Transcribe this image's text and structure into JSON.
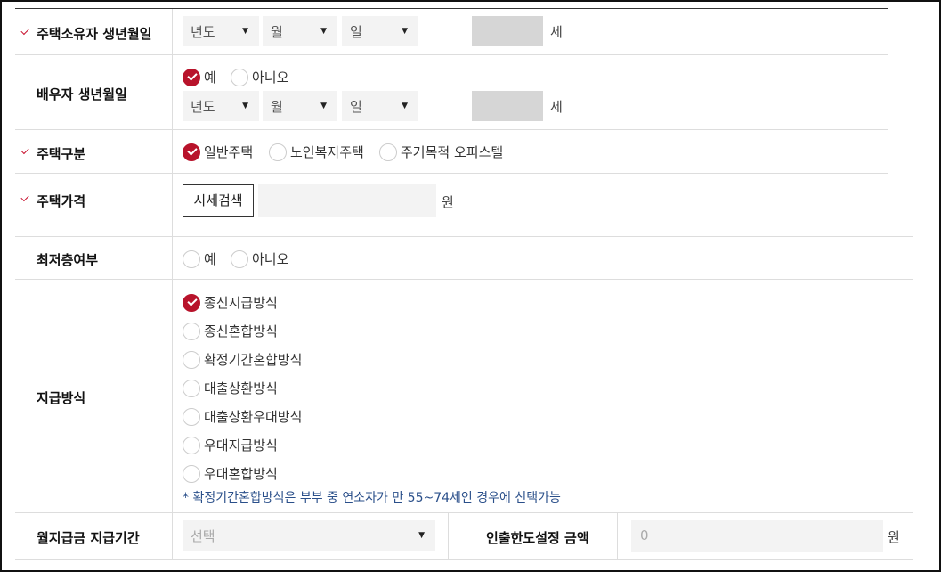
{
  "owner_birth": {
    "label": "주택소유자 생년월일",
    "year": "년도",
    "month": "월",
    "day": "일",
    "age_unit": "세"
  },
  "spouse_birth": {
    "label": "배우자 생년월일",
    "options": [
      "예",
      "아니오"
    ],
    "selected": "예",
    "year": "년도",
    "month": "월",
    "day": "일",
    "age_unit": "세"
  },
  "house_type": {
    "label": "주택구분",
    "options": [
      "일반주택",
      "노인복지주택",
      "주거목적 오피스텔"
    ],
    "selected": "일반주택"
  },
  "house_price": {
    "label": "주택가격",
    "search_button": "시세검색",
    "value": "",
    "unit": "원"
  },
  "lowest_floor": {
    "label": "최저층여부",
    "options": [
      "예",
      "아니오"
    ],
    "selected": ""
  },
  "payment_method": {
    "label": "지급방식",
    "options": [
      "종신지급방식",
      "종신혼합방식",
      "확정기간혼합방식",
      "대출상환방식",
      "대출상환우대방식",
      "우대지급방식",
      "우대혼합방식"
    ],
    "selected": "종신지급방식",
    "note": "* 확정기간혼합방식은 부부 중 연소자가 만 55~74세인 경우에 선택가능"
  },
  "monthly_period": {
    "label": "월지급금 지급기간",
    "placeholder": "선택"
  },
  "withdrawal_limit": {
    "label": "인출한도설정 금액",
    "value": "0",
    "unit": "원"
  },
  "colors": {
    "accent": "#b8132b",
    "note": "#2a4f8a",
    "field_bg": "#f3f3f3",
    "age_bg": "#d6d6d6"
  }
}
